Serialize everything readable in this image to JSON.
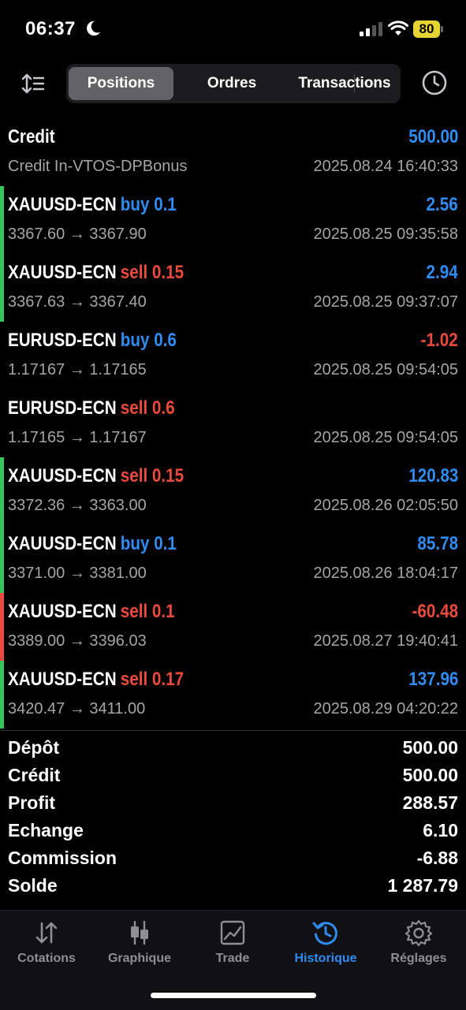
{
  "status": {
    "time": "06:37",
    "battery": "80"
  },
  "toolbar": {
    "tabs": [
      {
        "label": "Positions",
        "active": true
      },
      {
        "label": "Ordres",
        "active": false
      },
      {
        "label": "Transactions",
        "active": false
      }
    ]
  },
  "credit": {
    "title": "Credit",
    "value": "500.00",
    "sub": "Credit In-VTOS-DPBonus",
    "date": "2025.08.24 16:40:33"
  },
  "deals": [
    {
      "symbol": "XAUUSD-ECN",
      "side": "buy 0.1",
      "side_color": "blue",
      "prices": "3367.60 → 3367.90",
      "profit": "2.56",
      "profit_color": "blue",
      "date": "2025.08.25 09:35:58",
      "bar": "green"
    },
    {
      "symbol": "XAUUSD-ECN",
      "side": "sell 0.15",
      "side_color": "red",
      "prices": "3367.63 → 3367.40",
      "profit": "2.94",
      "profit_color": "blue",
      "date": "2025.08.25 09:37:07",
      "bar": "green"
    },
    {
      "symbol": "EURUSD-ECN",
      "side": "buy 0.6",
      "side_color": "blue",
      "prices": "1.17167 → 1.17165",
      "profit": "-1.02",
      "profit_color": "red",
      "date": "2025.08.25 09:54:05",
      "bar": "none"
    },
    {
      "symbol": "EURUSD-ECN",
      "side": "sell 0.6",
      "side_color": "red",
      "prices": "1.17165 → 1.17167",
      "profit": "",
      "profit_color": "blue",
      "date": "2025.08.25 09:54:05",
      "bar": "none"
    },
    {
      "symbol": "XAUUSD-ECN",
      "side": "sell 0.15",
      "side_color": "red",
      "prices": "3372.36 → 3363.00",
      "profit": "120.83",
      "profit_color": "blue",
      "date": "2025.08.26 02:05:50",
      "bar": "green"
    },
    {
      "symbol": "XAUUSD-ECN",
      "side": "buy 0.1",
      "side_color": "blue",
      "prices": "3371.00 → 3381.00",
      "profit": "85.78",
      "profit_color": "blue",
      "date": "2025.08.26 18:04:17",
      "bar": "green"
    },
    {
      "symbol": "XAUUSD-ECN",
      "side": "sell 0.1",
      "side_color": "red",
      "prices": "3389.00 → 3396.03",
      "profit": "-60.48",
      "profit_color": "red",
      "date": "2025.08.27 19:40:41",
      "bar": "red"
    },
    {
      "symbol": "XAUUSD-ECN",
      "side": "sell 0.17",
      "side_color": "red",
      "prices": "3420.47 → 3411.00",
      "profit": "137.96",
      "profit_color": "blue",
      "date": "2025.08.29 04:20:22",
      "bar": "green"
    }
  ],
  "summary": [
    {
      "label": "Dépôt",
      "value": "500.00"
    },
    {
      "label": "Crédit",
      "value": "500.00"
    },
    {
      "label": "Profit",
      "value": "288.57"
    },
    {
      "label": "Echange",
      "value": "6.10"
    },
    {
      "label": "Commission",
      "value": "-6.88"
    },
    {
      "label": "Solde",
      "value": "1 287.79"
    }
  ],
  "tabbar": {
    "items": [
      {
        "label": "Cotations",
        "icon": "arrows-updown-icon",
        "active": false
      },
      {
        "label": "Graphique",
        "icon": "candlestick-icon",
        "active": false
      },
      {
        "label": "Trade",
        "icon": "chart-line-icon",
        "active": false
      },
      {
        "label": "Historique",
        "icon": "history-icon",
        "active": true
      },
      {
        "label": "Réglages",
        "icon": "gear-icon",
        "active": false
      }
    ]
  },
  "colors": {
    "blue": "#2f8cf2",
    "red": "#eb4a3c",
    "green": "#34c759",
    "segment_active": "#636366"
  }
}
